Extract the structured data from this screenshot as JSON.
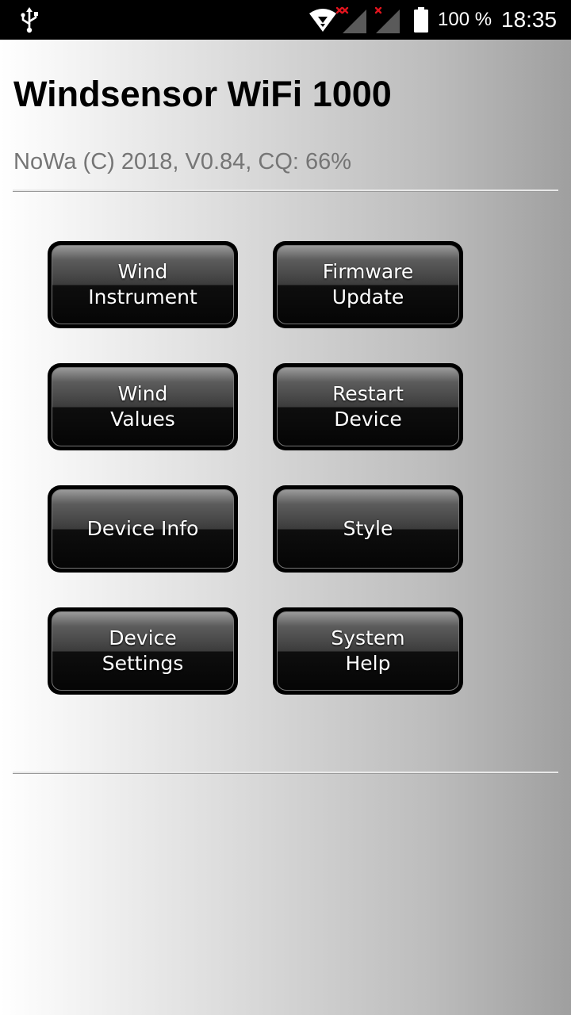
{
  "status_bar": {
    "battery_text": "100 %",
    "time": "18:35",
    "icons": [
      "usb-icon",
      "wifi-icon",
      "signal-no-service-icon",
      "signal-no-service-icon",
      "battery-full-icon"
    ]
  },
  "header": {
    "title": "Windsensor WiFi 1000",
    "subtitle": "NoWa (C) 2018, V0.84, CQ: 66%"
  },
  "menu": {
    "wind_instrument": "Wind\nInstrument",
    "firmware_update": "Firmware\nUpdate",
    "wind_values": "Wind\nValues",
    "restart_device": "Restart\nDevice",
    "device_info": "Device Info",
    "style": "Style",
    "device_settings": "Device\nSettings",
    "system_help": "System\nHelp"
  },
  "colors": {
    "status_bar_bg": "#000000",
    "button_bg": "#000000",
    "button_text": "#ffffff",
    "title_text": "#000000",
    "subtitle_text": "#757575",
    "no_service_mark": "#e0141e"
  }
}
